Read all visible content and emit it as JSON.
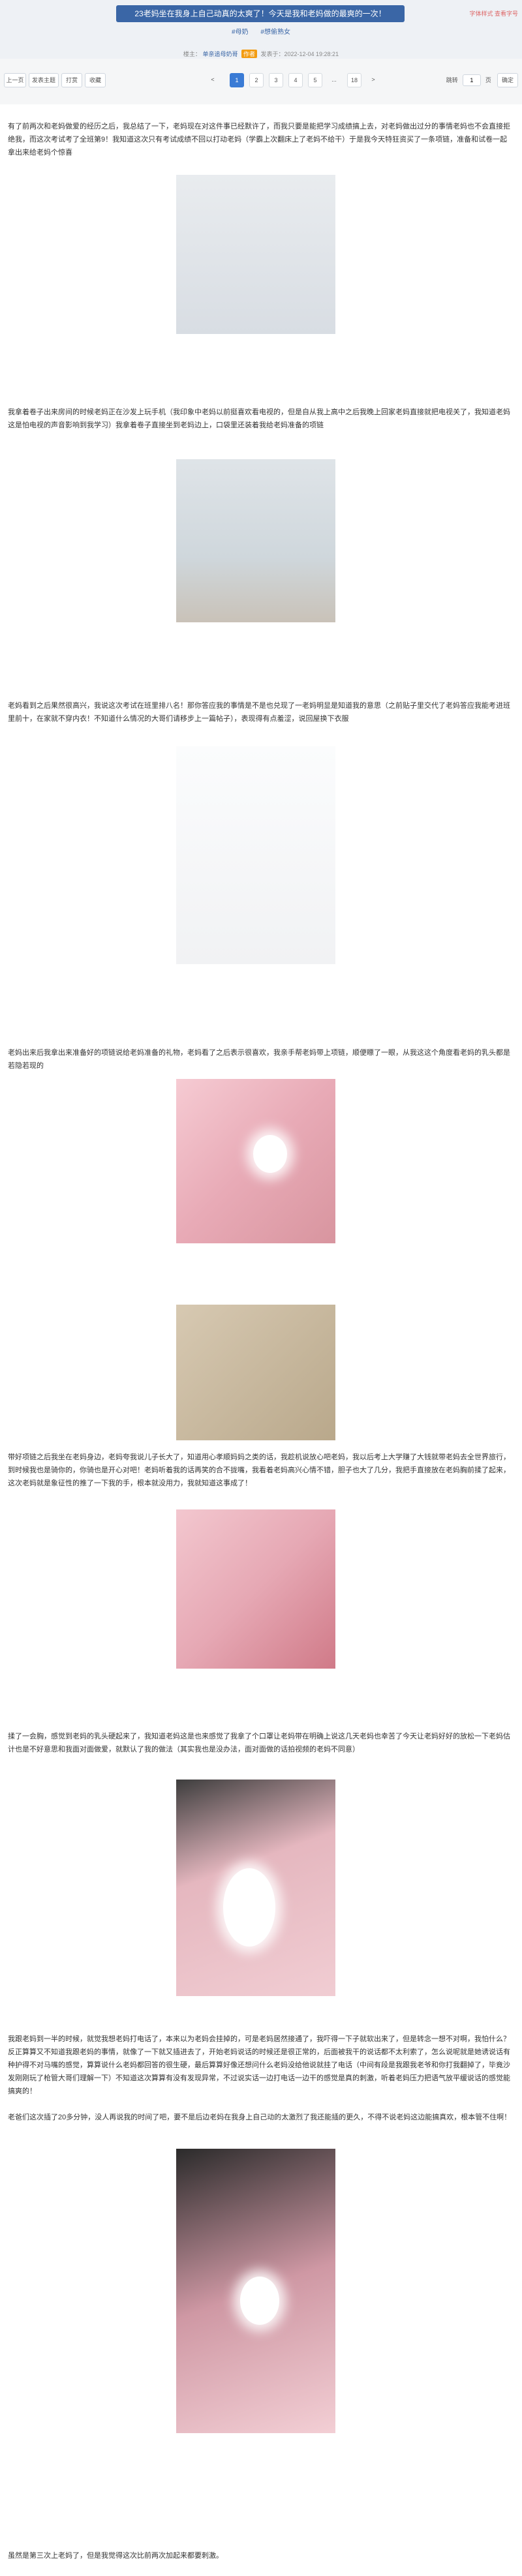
{
  "header": {
    "title": "23老妈坐在我身上自己动真的太爽了！今天是我和老妈做的最爽的一次！",
    "tags": [
      "#母奶",
      "#想偷熟女"
    ],
    "byline": {
      "prefix": "楼主：",
      "author": "单亲追母奶哥",
      "badge": "作者",
      "time": "发表于：2022-12-04 19:28:21"
    },
    "meta_right": "字体样式  查看字号"
  },
  "toolbar": {
    "buttons": [
      "上一页",
      "发表主题",
      "打赏",
      "收藏"
    ],
    "pager": [
      "<",
      "1",
      "2",
      "3",
      "4",
      "5",
      "...",
      "18",
      ">"
    ],
    "jump_label": "跳转",
    "jump_value": "1",
    "jump_unit": "页",
    "jump_button": "确定"
  },
  "content": {
    "paragraphs": [
      "有了前两次和老妈做爱的经历之后，我总结了一下，老妈现在对这件事已经默许了，而我只要是能把学习成绩搞上去，对老妈做出过分的事情老妈也不会直接拒绝我，而这次考试考了全班第9！我知道这次只有考试成绩不回以打动老妈（学霸上次翻床上了老妈不给干）于是我今天特狂资买了一条项链，准备和试卷一起拿出来给老妈个惊喜",
      "我拿着卷子出来房间的时候老妈正在沙发上玩手机（我印象中老妈以前挺喜欢看电视的，但是自从我上高中之后我晚上回家老妈直接就把电视关了，我知道老妈这是怕电视的声音影响到我学习）我拿着卷子直接坐到老妈边上，口袋里还装着我给老妈准备的项链",
      "老妈看到之后果然很高兴，我说这次考试在班里排八名！那你答应我的事情是不是也兑现了一老妈明显是知道我的意思（之前贴子里交代了老妈答应我能考进班里前十，在家就不穿内衣！不知道什么情况的大哥们请移步上一篇帖子），表现得有点羞涩，说回屋换下衣服",
      "老妈出来后我拿出来准备好的项链说给老妈准备的礼物，老妈看了之后表示很喜欢，我亲手帮老妈带上项链，顺便瞟了一眼，从我这这个角度看老妈的乳头都是若隐若现的",
      "带好项链之后我坐在老妈身边，老妈夸我说儿子长大了，知道用心孝顺妈妈之类的话，我趁机说放心吧老妈，我以后考上大学赚了大钱就带老妈去全世界旅行，到时候我也是骑你的，你骑也是开心对吧！老妈听着我的话再笑的合不拢嘴，我看着老妈高兴心情不错，胆子也大了几分，我把手直接放在老妈胸前揉了起来，这次老妈就是象征性的推了一下我的手，根本就没用力，我就知道这事成了！",
      "揉了一会胸，感觉到老妈的乳头硬起来了，我知道老妈这是也来感觉了我拿了个口罩让老妈带在明确上说这几天老妈也幸苦了今天让老妈好好的放松一下老妈估计也是不好意思和我面对面做爱，就默认了我的做法（其实我也是没办法，面对面做的话拍视频的老妈不同意）",
      "我跟老妈到一半的时候，就觉我想老妈打电话了，本来以为老妈会挂掉的，可是老妈居然接通了，我吓得一下子就软出来了，但是转念一想不对啊，我怕什么？反正算算又不知道我跟老妈的事情，就像了一下就又插进去了，开始老妈说话的时候还是很正常的，后面被我干的说话都不太利索了，怎么说呢就是她诱说话有种护得不对马嘴的感觉，算算说什么老妈都回答的很生硬，最后算算好像还想问什么老妈没给他说就挂了电话（中间有段是我跟我老爷和你打我翻掉了，毕竟沙发刚刚玩了枪管大哥们理解一下）不知道这次算算有没有发现异常，不过说实话一边打电话一边干的感觉是真的刺激，听着老妈压力把语气放平缓说话的感觉能搞爽的！",
      "老爸们这次插了20多分钟，没人再说我的时间了吧，要不是后边老妈在我身上自己动的太激烈了我还能插的更久，不得不说老妈这边能搞真欢，根本管不住啊！",
      "虽然是第三次上老妈了，但是我觉得这次比前两次加起来都要刺激。"
    ]
  }
}
